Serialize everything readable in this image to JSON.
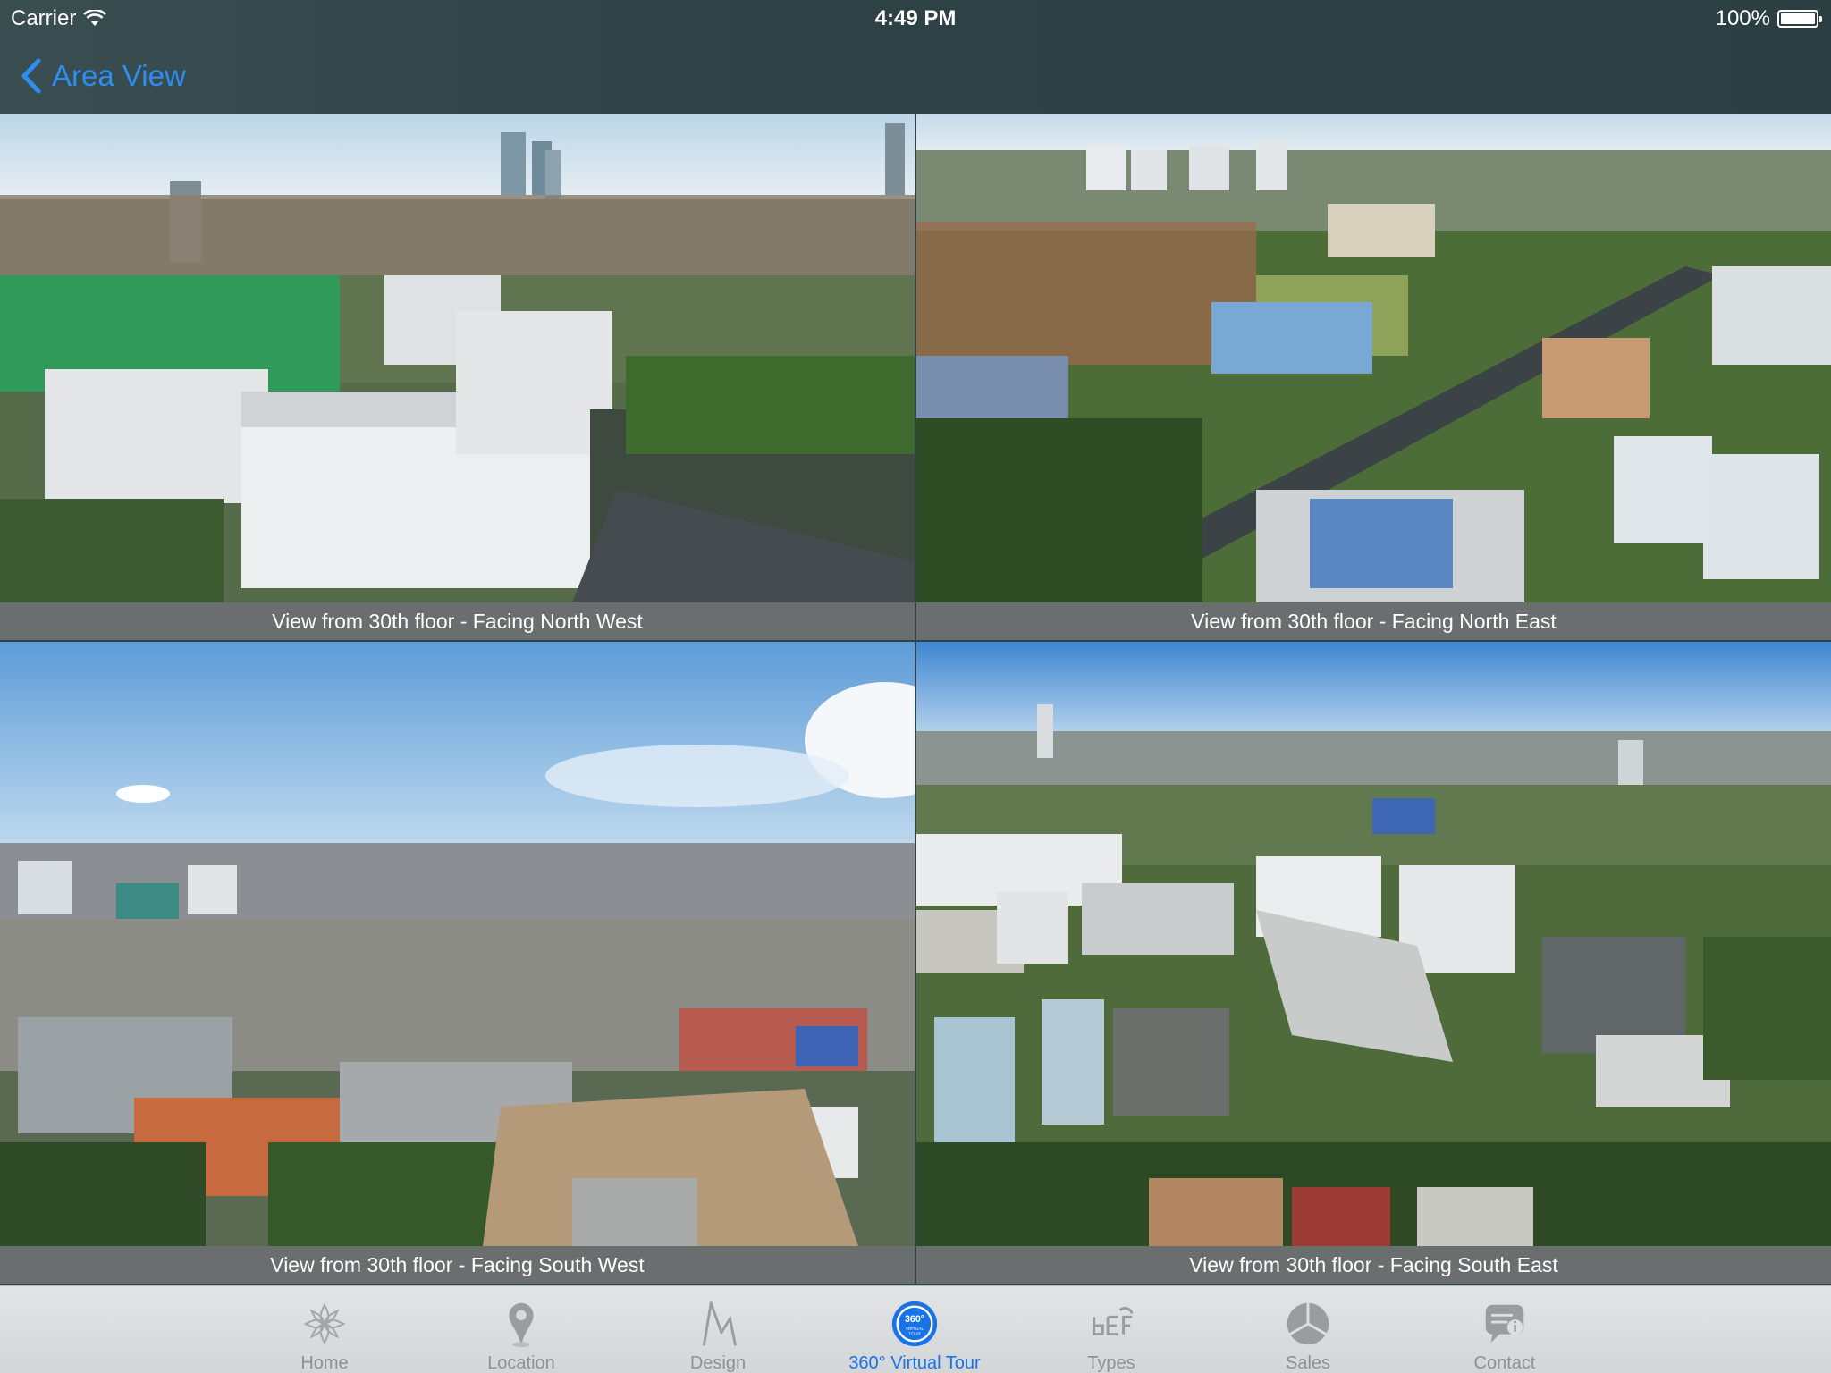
{
  "status_bar": {
    "carrier": "Carrier",
    "time": "4:49 PM",
    "battery": "100%"
  },
  "nav": {
    "back_label": "Area View"
  },
  "views": [
    {
      "caption": "View from 30th floor - Facing North West"
    },
    {
      "caption": "View from 30th floor - Facing North East"
    },
    {
      "caption": "View from 30th floor - Facing South West"
    },
    {
      "caption": "View from 30th floor - Facing South East"
    }
  ],
  "tabbar": {
    "tabs": [
      {
        "label": "Home",
        "icon": "flower-logo-icon",
        "active": false
      },
      {
        "label": "Location",
        "icon": "map-pin-icon",
        "active": false
      },
      {
        "label": "Design",
        "icon": "compass-drawing-icon",
        "active": false
      },
      {
        "label": "360° Virtual Tour",
        "icon": "360-virtual-tour-icon",
        "active": true
      },
      {
        "label": "Types",
        "icon": "floorplan-types-icon",
        "active": false
      },
      {
        "label": "Sales",
        "icon": "pie-chart-icon",
        "active": false
      },
      {
        "label": "Contact",
        "icon": "chat-info-icon",
        "active": false
      }
    ]
  },
  "colors": {
    "accent": "#1a73e6",
    "nav_tint": "#2d8ef0",
    "header_bg": "#2f4246",
    "caption_bg": "#6b6e6e",
    "tab_inactive": "#8e9192"
  }
}
